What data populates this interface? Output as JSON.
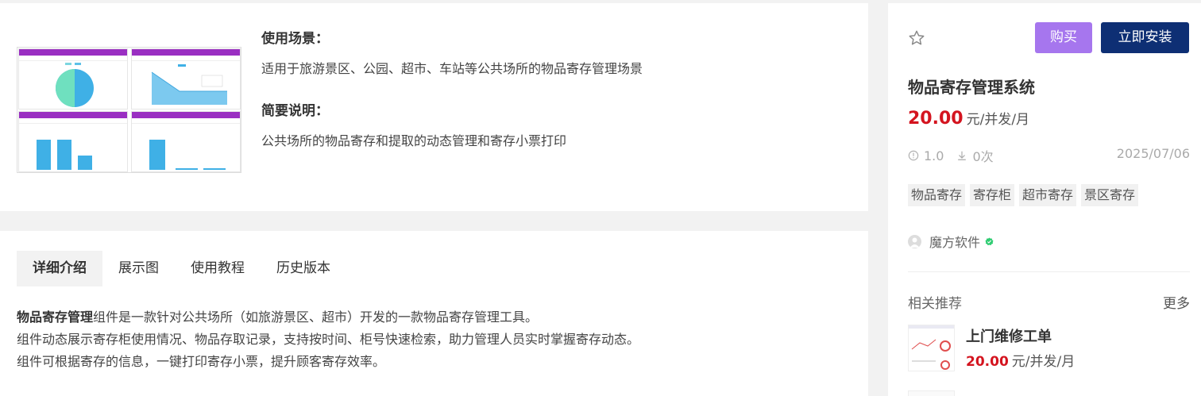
{
  "intro": {
    "scene_heading": "使用场景：",
    "scene_text": "适用于旅游景区、公园、超市、车站等公共场所的物品寄存管理场景",
    "brief_heading": "简要说明：",
    "brief_text": "公共场所的物品寄存和提取的动态管理和寄存小票打印"
  },
  "tabs": [
    {
      "label": "详细介绍",
      "active": true
    },
    {
      "label": "展示图",
      "active": false
    },
    {
      "label": "使用教程",
      "active": false
    },
    {
      "label": "历史版本",
      "active": false
    }
  ],
  "description": {
    "bold_lead": "物品寄存管理",
    "line1_rest": "组件是一款针对公共场所（如旅游景区、超市）开发的一款物品寄存管理工具。",
    "line2": "组件动态展示寄存柜使用情况、物品存取记录，支持按时间、柜号快速检索，助力管理人员实时掌握寄存动态。",
    "line3": "组件可根据寄存的信息，一键打印寄存小票，提升顾客寄存效率。"
  },
  "product": {
    "buy_label": "购买",
    "install_label": "立即安装",
    "title": "物品寄存管理系统",
    "price": "20.00",
    "price_unit": "元/并发/月",
    "version": "1.0",
    "downloads": "0次",
    "date": "2025/07/06",
    "tags": [
      "物品寄存",
      "寄存柜",
      "超市寄存",
      "景区寄存"
    ],
    "author": "魔方软件"
  },
  "related": {
    "title": "相关推荐",
    "more": "更多",
    "items": [
      {
        "name": "上门维修工单",
        "price": "20.00",
        "unit": "元/并发/月"
      }
    ]
  },
  "colors": {
    "accent_purple": "#9a2fc2",
    "buy_button": "#a676ee",
    "install_button": "#0e2f74",
    "price_red": "#d4141f"
  }
}
